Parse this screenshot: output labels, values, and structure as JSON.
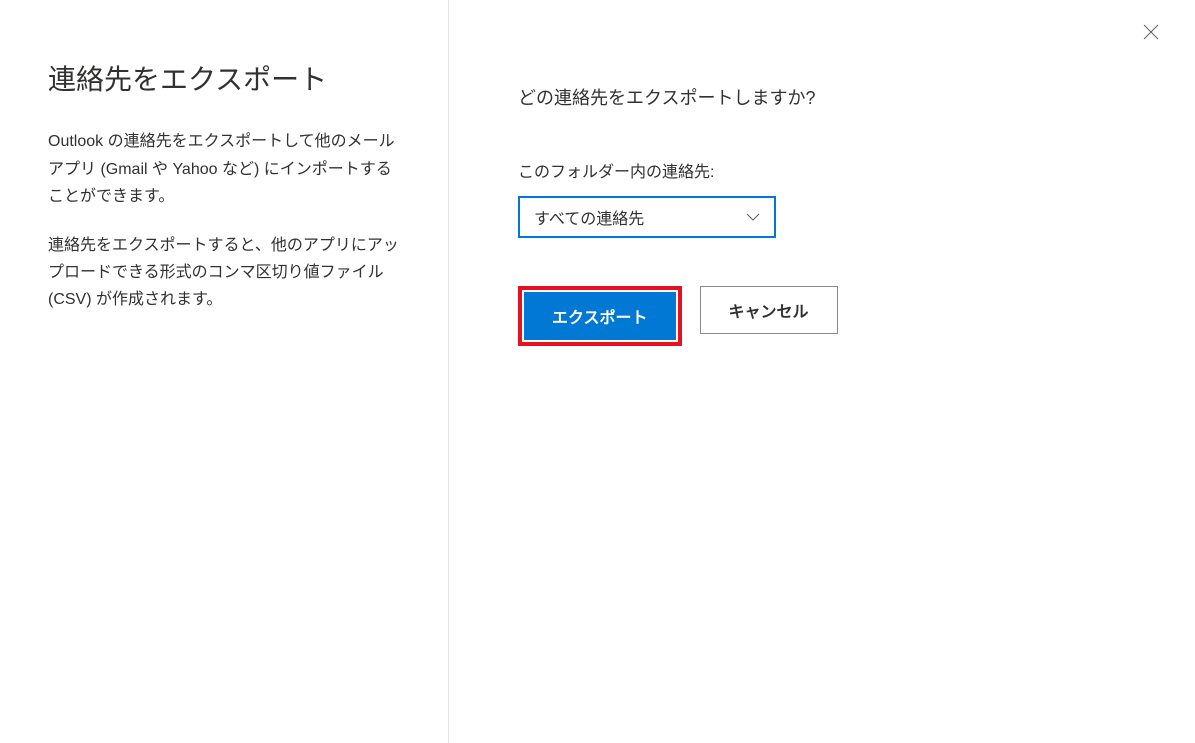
{
  "left": {
    "title": "連絡先をエクスポート",
    "description1": "Outlook の連絡先をエクスポートして他のメール アプリ (Gmail や Yahoo など) にインポートすることができます。",
    "description2": "連絡先をエクスポートすると、他のアプリにアップロードできる形式のコンマ区切り値ファイル (CSV) が作成されます。"
  },
  "right": {
    "prompt": "どの連絡先をエクスポートしますか?",
    "folder_label": "このフォルダー内の連絡先:",
    "dropdown_selected": "すべての連絡先",
    "export_button": "エクスポート",
    "cancel_button": "キャンセル"
  }
}
